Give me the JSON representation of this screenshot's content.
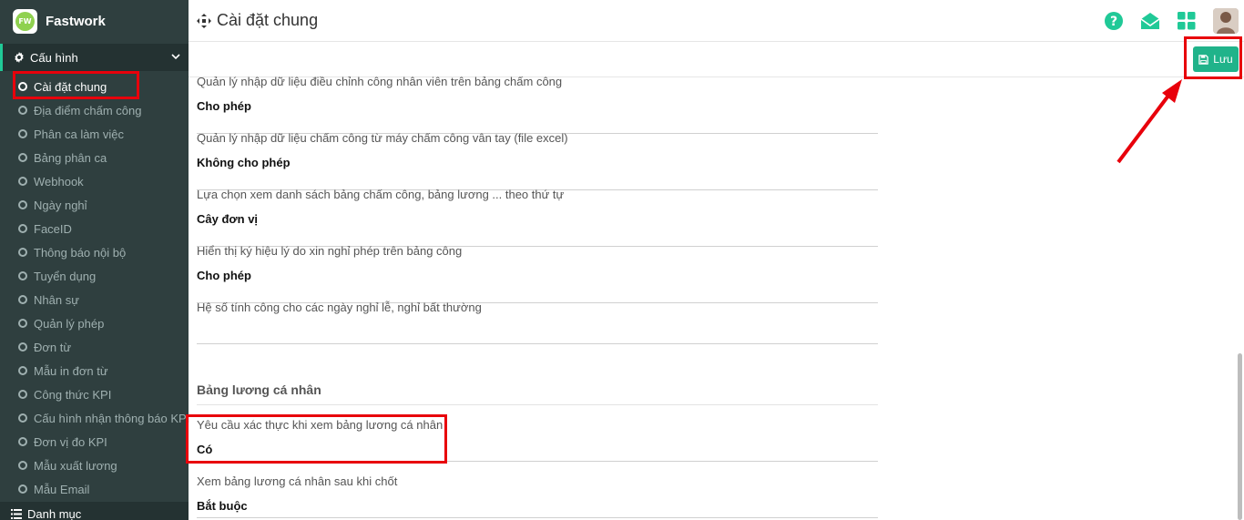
{
  "brand": {
    "name": "Fastwork",
    "logo_text": "FW"
  },
  "sidebar": {
    "section": "Cấu hình",
    "items": [
      {
        "label": "Cài đặt chung",
        "active": true
      },
      {
        "label": "Địa điểm chấm công"
      },
      {
        "label": "Phân ca làm việc"
      },
      {
        "label": "Bảng phân ca"
      },
      {
        "label": "Webhook"
      },
      {
        "label": "Ngày nghỉ"
      },
      {
        "label": "FaceID"
      },
      {
        "label": "Thông báo nội bộ"
      },
      {
        "label": "Tuyển dụng"
      },
      {
        "label": "Nhân sự"
      },
      {
        "label": "Quản lý phép"
      },
      {
        "label": "Đơn từ"
      },
      {
        "label": "Mẫu in đơn từ"
      },
      {
        "label": "Công thức KPI"
      },
      {
        "label": "Cấu hình nhận thông báo KPI"
      },
      {
        "label": "Đơn vị đo KPI"
      },
      {
        "label": "Mẫu xuất lương"
      },
      {
        "label": "Mẫu Email"
      }
    ],
    "next_section": "Danh mục"
  },
  "header": {
    "title": "Cài đặt chung"
  },
  "toolbar": {
    "save_label": "Lưu"
  },
  "settings": [
    {
      "label": "Quản lý nhập dữ liệu điều chỉnh công nhân viên trên bảng chấm công",
      "value": "Cho phép"
    },
    {
      "label": "Quản lý nhập dữ liệu chấm công từ máy chấm công vân tay (file excel)",
      "value": "Không cho phép"
    },
    {
      "label": "Lựa chọn xem danh sách bảng chấm công, bảng lương ... theo thứ tự",
      "value": "Cây đơn vị"
    },
    {
      "label": "Hiển thị ký hiệu lý do xin nghỉ phép trên bảng công",
      "value": "Cho phép"
    },
    {
      "label": "Hệ số tính công cho các ngày nghỉ lễ, nghỉ bất thường",
      "value": ""
    }
  ],
  "payslip_section": {
    "title": "Bảng lương cá nhân",
    "settings": [
      {
        "label": "Yêu cầu xác thực khi xem bảng lương cá nhân",
        "value": "Có"
      },
      {
        "label": "Xem bảng lương cá nhân sau khi chốt",
        "value": "Bắt buộc"
      }
    ]
  },
  "colors": {
    "accent": "#20b38a",
    "sidebar": "#2f3f3f",
    "highlight": "#e8000b"
  }
}
